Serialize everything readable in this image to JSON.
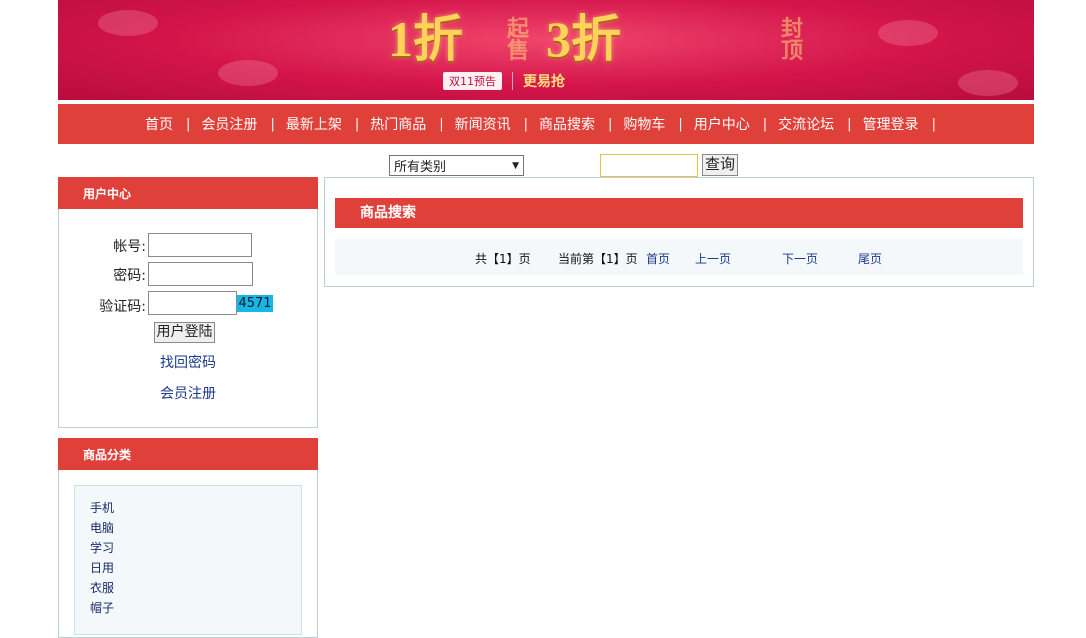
{
  "banner": {
    "top_logo": "",
    "promo_1": "1折",
    "promo_1_small_a": "起",
    "promo_1_small_b": "售",
    "promo_2": "3折",
    "promo_2_small_a": "封",
    "promo_2_small_b": "顶",
    "sub_box": "双11预告",
    "sub_text": "更易抢"
  },
  "nav": {
    "items": [
      "首页",
      "会员注册",
      "最新上架",
      "热门商品",
      "新闻资讯",
      "商品搜索",
      "购物车",
      "用户中心",
      "交流论坛",
      "管理登录"
    ],
    "separator": "|"
  },
  "search": {
    "category_selected": "所有类别",
    "keyword_value": "",
    "button_label": "查询"
  },
  "user_center": {
    "title": "用户中心",
    "account_label": "帐号:",
    "password_label": "密码:",
    "captcha_label": "验证码:",
    "captcha_code": "4571",
    "login_button": "用户登陆",
    "find_password": "找回密码",
    "register": "会员注册"
  },
  "categories": {
    "title": "商品分类",
    "items": [
      "手机",
      "电脑",
      "学习",
      "日用",
      "衣服",
      "帽子"
    ]
  },
  "main": {
    "title": "商品搜索",
    "total_pages_text": "共【1】页",
    "current_page_text": "当前第【1】页",
    "first": "首页",
    "prev": "上一页",
    "next": "下一页",
    "last": "尾页"
  },
  "colors": {
    "accent": "#e0403a",
    "banner": "#d3144a",
    "link": "#1a3a8a",
    "captcha_bg": "#15b6e8"
  }
}
